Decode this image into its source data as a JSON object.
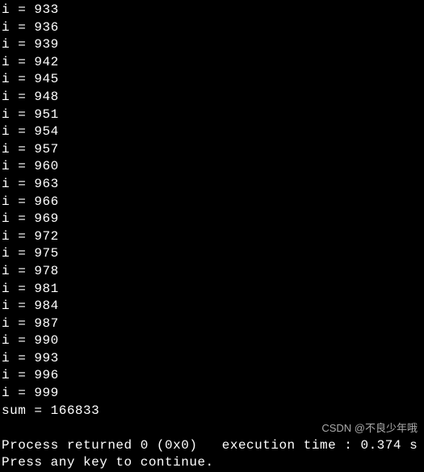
{
  "console": {
    "loop_lines": [
      {
        "var": "i",
        "eq": "=",
        "val": "933"
      },
      {
        "var": "i",
        "eq": "=",
        "val": "936"
      },
      {
        "var": "i",
        "eq": "=",
        "val": "939"
      },
      {
        "var": "i",
        "eq": "=",
        "val": "942"
      },
      {
        "var": "i",
        "eq": "=",
        "val": "945"
      },
      {
        "var": "i",
        "eq": "=",
        "val": "948"
      },
      {
        "var": "i",
        "eq": "=",
        "val": "951"
      },
      {
        "var": "i",
        "eq": "=",
        "val": "954"
      },
      {
        "var": "i",
        "eq": "=",
        "val": "957"
      },
      {
        "var": "i",
        "eq": "=",
        "val": "960"
      },
      {
        "var": "i",
        "eq": "=",
        "val": "963"
      },
      {
        "var": "i",
        "eq": "=",
        "val": "966"
      },
      {
        "var": "i",
        "eq": "=",
        "val": "969"
      },
      {
        "var": "i",
        "eq": "=",
        "val": "972"
      },
      {
        "var": "i",
        "eq": "=",
        "val": "975"
      },
      {
        "var": "i",
        "eq": "=",
        "val": "978"
      },
      {
        "var": "i",
        "eq": "=",
        "val": "981"
      },
      {
        "var": "i",
        "eq": "=",
        "val": "984"
      },
      {
        "var": "i",
        "eq": "=",
        "val": "987"
      },
      {
        "var": "i",
        "eq": "=",
        "val": "990"
      },
      {
        "var": "i",
        "eq": "=",
        "val": "993"
      },
      {
        "var": "i",
        "eq": "=",
        "val": "996"
      },
      {
        "var": "i",
        "eq": "=",
        "val": "999"
      }
    ],
    "sum_line": "sum = 166833",
    "process_line": "Process returned 0 (0x0)   execution time : 0.374 s",
    "continue_line": "Press any key to continue."
  },
  "watermark": "CSDN @不良少年哦"
}
